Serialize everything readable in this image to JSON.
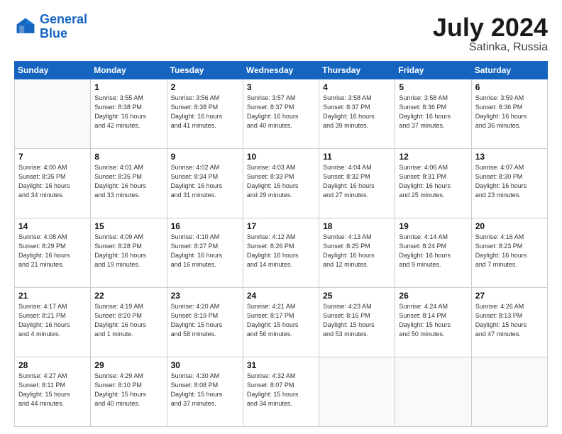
{
  "header": {
    "logo_line1": "General",
    "logo_line2": "Blue",
    "month": "July 2024",
    "location": "Satinka, Russia"
  },
  "weekdays": [
    "Sunday",
    "Monday",
    "Tuesday",
    "Wednesday",
    "Thursday",
    "Friday",
    "Saturday"
  ],
  "weeks": [
    [
      {
        "day": "",
        "info": ""
      },
      {
        "day": "1",
        "info": "Sunrise: 3:55 AM\nSunset: 8:38 PM\nDaylight: 16 hours\nand 42 minutes."
      },
      {
        "day": "2",
        "info": "Sunrise: 3:56 AM\nSunset: 8:38 PM\nDaylight: 16 hours\nand 41 minutes."
      },
      {
        "day": "3",
        "info": "Sunrise: 3:57 AM\nSunset: 8:37 PM\nDaylight: 16 hours\nand 40 minutes."
      },
      {
        "day": "4",
        "info": "Sunrise: 3:58 AM\nSunset: 8:37 PM\nDaylight: 16 hours\nand 39 minutes."
      },
      {
        "day": "5",
        "info": "Sunrise: 3:58 AM\nSunset: 8:36 PM\nDaylight: 16 hours\nand 37 minutes."
      },
      {
        "day": "6",
        "info": "Sunrise: 3:59 AM\nSunset: 8:36 PM\nDaylight: 16 hours\nand 36 minutes."
      }
    ],
    [
      {
        "day": "7",
        "info": "Sunrise: 4:00 AM\nSunset: 8:35 PM\nDaylight: 16 hours\nand 34 minutes."
      },
      {
        "day": "8",
        "info": "Sunrise: 4:01 AM\nSunset: 8:35 PM\nDaylight: 16 hours\nand 33 minutes."
      },
      {
        "day": "9",
        "info": "Sunrise: 4:02 AM\nSunset: 8:34 PM\nDaylight: 16 hours\nand 31 minutes."
      },
      {
        "day": "10",
        "info": "Sunrise: 4:03 AM\nSunset: 8:33 PM\nDaylight: 16 hours\nand 29 minutes."
      },
      {
        "day": "11",
        "info": "Sunrise: 4:04 AM\nSunset: 8:32 PM\nDaylight: 16 hours\nand 27 minutes."
      },
      {
        "day": "12",
        "info": "Sunrise: 4:06 AM\nSunset: 8:31 PM\nDaylight: 16 hours\nand 25 minutes."
      },
      {
        "day": "13",
        "info": "Sunrise: 4:07 AM\nSunset: 8:30 PM\nDaylight: 16 hours\nand 23 minutes."
      }
    ],
    [
      {
        "day": "14",
        "info": "Sunrise: 4:08 AM\nSunset: 8:29 PM\nDaylight: 16 hours\nand 21 minutes."
      },
      {
        "day": "15",
        "info": "Sunrise: 4:09 AM\nSunset: 8:28 PM\nDaylight: 16 hours\nand 19 minutes."
      },
      {
        "day": "16",
        "info": "Sunrise: 4:10 AM\nSunset: 8:27 PM\nDaylight: 16 hours\nand 16 minutes."
      },
      {
        "day": "17",
        "info": "Sunrise: 4:12 AM\nSunset: 8:26 PM\nDaylight: 16 hours\nand 14 minutes."
      },
      {
        "day": "18",
        "info": "Sunrise: 4:13 AM\nSunset: 8:25 PM\nDaylight: 16 hours\nand 12 minutes."
      },
      {
        "day": "19",
        "info": "Sunrise: 4:14 AM\nSunset: 8:24 PM\nDaylight: 16 hours\nand 9 minutes."
      },
      {
        "day": "20",
        "info": "Sunrise: 4:16 AM\nSunset: 8:23 PM\nDaylight: 16 hours\nand 7 minutes."
      }
    ],
    [
      {
        "day": "21",
        "info": "Sunrise: 4:17 AM\nSunset: 8:21 PM\nDaylight: 16 hours\nand 4 minutes."
      },
      {
        "day": "22",
        "info": "Sunrise: 4:19 AM\nSunset: 8:20 PM\nDaylight: 16 hours\nand 1 minute."
      },
      {
        "day": "23",
        "info": "Sunrise: 4:20 AM\nSunset: 8:19 PM\nDaylight: 15 hours\nand 58 minutes."
      },
      {
        "day": "24",
        "info": "Sunrise: 4:21 AM\nSunset: 8:17 PM\nDaylight: 15 hours\nand 56 minutes."
      },
      {
        "day": "25",
        "info": "Sunrise: 4:23 AM\nSunset: 8:16 PM\nDaylight: 15 hours\nand 53 minutes."
      },
      {
        "day": "26",
        "info": "Sunrise: 4:24 AM\nSunset: 8:14 PM\nDaylight: 15 hours\nand 50 minutes."
      },
      {
        "day": "27",
        "info": "Sunrise: 4:26 AM\nSunset: 8:13 PM\nDaylight: 15 hours\nand 47 minutes."
      }
    ],
    [
      {
        "day": "28",
        "info": "Sunrise: 4:27 AM\nSunset: 8:11 PM\nDaylight: 15 hours\nand 44 minutes."
      },
      {
        "day": "29",
        "info": "Sunrise: 4:29 AM\nSunset: 8:10 PM\nDaylight: 15 hours\nand 40 minutes."
      },
      {
        "day": "30",
        "info": "Sunrise: 4:30 AM\nSunset: 8:08 PM\nDaylight: 15 hours\nand 37 minutes."
      },
      {
        "day": "31",
        "info": "Sunrise: 4:32 AM\nSunset: 8:07 PM\nDaylight: 15 hours\nand 34 minutes."
      },
      {
        "day": "",
        "info": ""
      },
      {
        "day": "",
        "info": ""
      },
      {
        "day": "",
        "info": ""
      }
    ]
  ]
}
